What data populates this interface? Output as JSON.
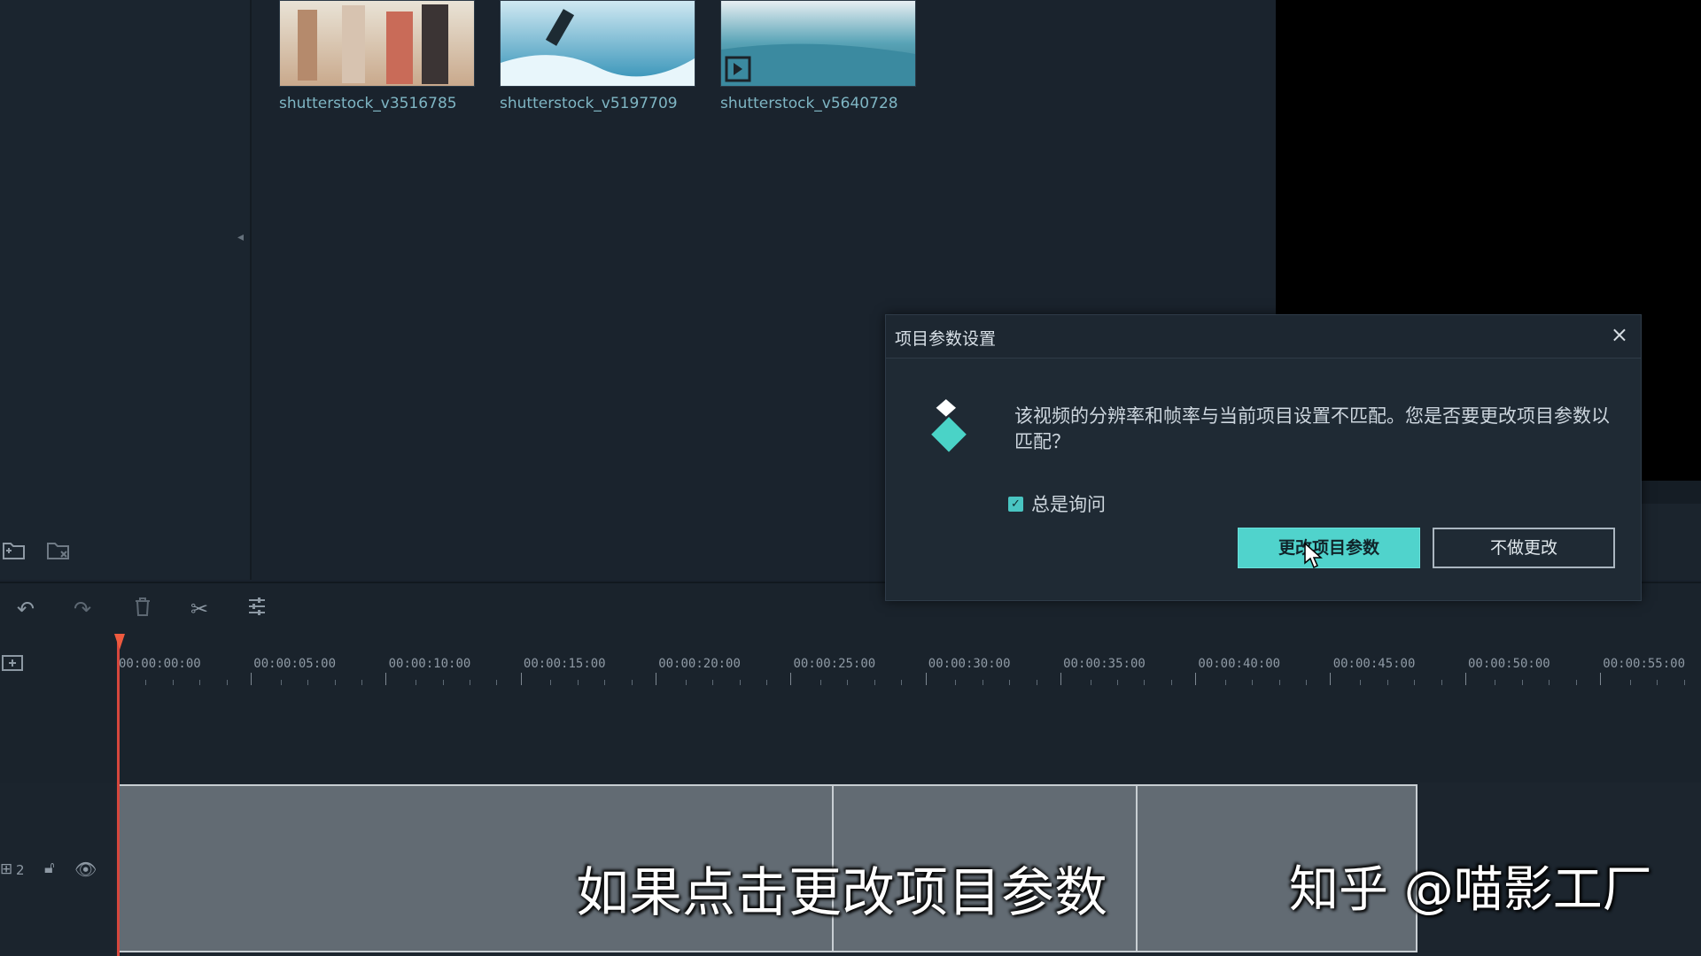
{
  "media": {
    "items": [
      {
        "label": "shutterstock_v3516785"
      },
      {
        "label": "shutterstock_v5197709"
      },
      {
        "label": "shutterstock_v5640728"
      }
    ]
  },
  "timeline": {
    "ticks": [
      "00:00:00:00",
      "00:00:05:00",
      "00:00:10:00",
      "00:00:15:00",
      "00:00:20:00",
      "00:00:25:00",
      "00:00:30:00",
      "00:00:35:00",
      "00:00:40:00",
      "00:00:45:00",
      "00:00:50:00",
      "00:00:55:00"
    ],
    "track_number": "2"
  },
  "dialog": {
    "title": "项目参数设置",
    "close": "×",
    "message": "该视频的分辨率和帧率与当前项目设置不匹配。您是否要更改项目参数以匹配？",
    "checkbox_label": "总是询问",
    "checkbox_checked": true,
    "primary_button": "更改项目参数",
    "secondary_button": "不做更改"
  },
  "overlay": {
    "subtitle": "如果点击更改项目参数",
    "watermark": "知乎 @喵影工厂"
  },
  "colors": {
    "accent": "#50d3cc",
    "playhead": "#d6473d"
  }
}
